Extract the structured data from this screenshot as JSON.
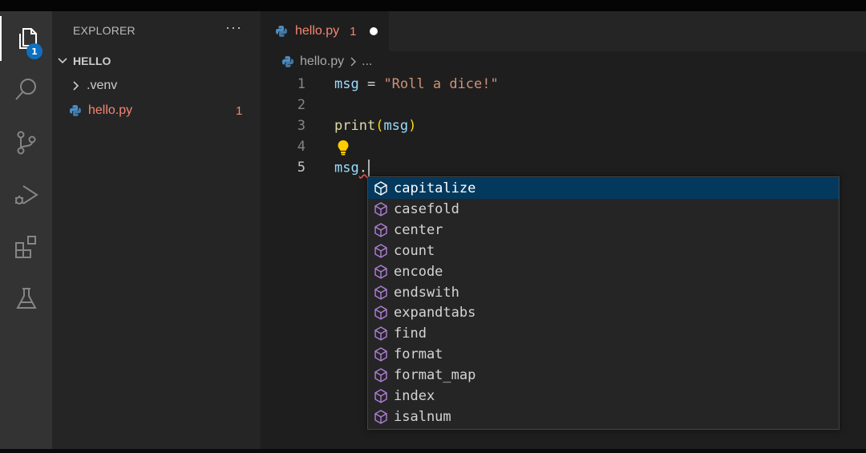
{
  "activity_bar": {
    "explorer_badge": "1",
    "items": [
      "files-icon",
      "search-icon",
      "source-control-icon",
      "run-debug-icon",
      "extensions-icon",
      "testing-icon"
    ]
  },
  "sidebar": {
    "title": "EXPLORER",
    "more": "···",
    "folder": "HELLO",
    "items": [
      {
        "name": ".venv",
        "type": "folder"
      },
      {
        "name": "hello.py",
        "type": "python-file",
        "problems": "1"
      }
    ]
  },
  "editor": {
    "tab": {
      "name": "hello.py",
      "problems": "1"
    },
    "breadcrumb": {
      "file": "hello.py",
      "more": "..."
    },
    "lines": [
      {
        "n": "1",
        "tokens": [
          "msg",
          " = ",
          "\"Roll a dice!\""
        ]
      },
      {
        "n": "2"
      },
      {
        "n": "3",
        "tokens": [
          "print",
          "(",
          "msg",
          ")"
        ]
      },
      {
        "n": "4"
      },
      {
        "n": "5",
        "tokens": [
          "msg",
          "."
        ]
      }
    ]
  },
  "suggestions": {
    "selected_index": 0,
    "items": [
      "capitalize",
      "casefold",
      "center",
      "count",
      "encode",
      "endswith",
      "expandtabs",
      "find",
      "format",
      "format_map",
      "index",
      "isalnum"
    ]
  },
  "colors": {
    "error": "#f48771",
    "selection": "#04395e",
    "accent": "#0e70c0",
    "method_icon": "#b180d7"
  }
}
